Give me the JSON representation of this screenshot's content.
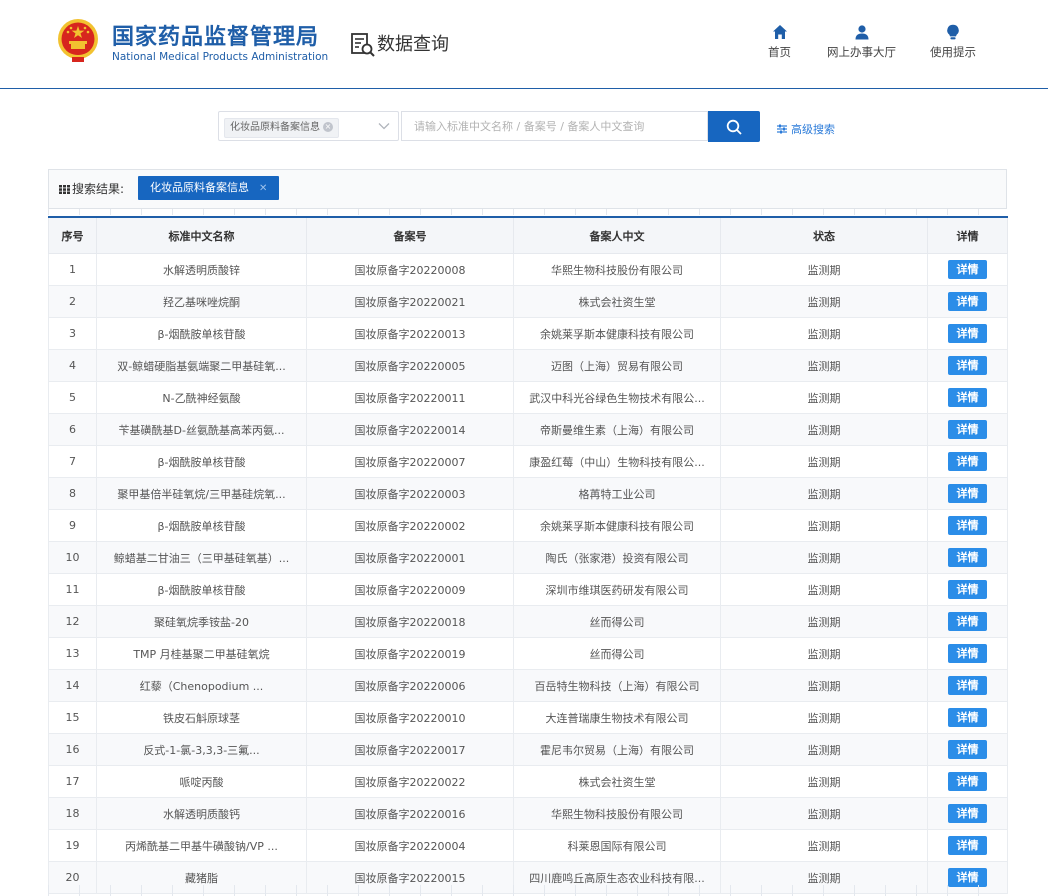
{
  "header": {
    "brand_cn": "国家药品监督管理局",
    "brand_en": "National Medical Products Administration",
    "section_title": "数据查询",
    "nav": [
      {
        "label": "首页",
        "icon": "home-icon"
      },
      {
        "label": "网上办事大厅",
        "icon": "user-icon"
      },
      {
        "label": "使用提示",
        "icon": "lightbulb-icon"
      }
    ]
  },
  "search": {
    "selected_category": "化妆品原料备案信息",
    "placeholder": "请输入标准中文名称 / 备案号 / 备案人中文查询",
    "advanced_label": "高级搜索"
  },
  "results": {
    "label": "搜索结果:",
    "tag": "化妆品原料备案信息"
  },
  "table": {
    "columns": [
      "序号",
      "标准中文名称",
      "备案号",
      "备案人中文",
      "状态",
      "详情"
    ],
    "detail_label": "详情",
    "rows": [
      [
        "1",
        "水解透明质酸锌",
        "国妆原备字20220008",
        "华熙生物科技股份有限公司",
        "监测期"
      ],
      [
        "2",
        "羟乙基咪唑烷酮",
        "国妆原备字20220021",
        "株式会社资生堂",
        "监测期"
      ],
      [
        "3",
        "β-烟酰胺单核苷酸",
        "国妆原备字20220013",
        "余姚莱孚斯本健康科技有限公司",
        "监测期"
      ],
      [
        "4",
        "双-鲸蜡硬脂基氨端聚二甲基硅氧...",
        "国妆原备字20220005",
        "迈图（上海）贸易有限公司",
        "监测期"
      ],
      [
        "5",
        "N-乙酰神经氨酸",
        "国妆原备字20220011",
        "武汉中科光谷绿色生物技术有限公...",
        "监测期"
      ],
      [
        "6",
        "苄基磺酰基D-丝氨酰基高苯丙氨...",
        "国妆原备字20220014",
        "帝斯曼维生素（上海）有限公司",
        "监测期"
      ],
      [
        "7",
        "β-烟酰胺单核苷酸",
        "国妆原备字20220007",
        "康盈红莓（中山）生物科技有限公...",
        "监测期"
      ],
      [
        "8",
        "聚甲基倍半硅氧烷/三甲基硅烷氧...",
        "国妆原备字20220003",
        "格苒特工业公司",
        "监测期"
      ],
      [
        "9",
        "β-烟酰胺单核苷酸",
        "国妆原备字20220002",
        "余姚莱孚斯本健康科技有限公司",
        "监测期"
      ],
      [
        "10",
        "鲸蜡基二甘油三（三甲基硅氧基）...",
        "国妆原备字20220001",
        "陶氏（张家港）投资有限公司",
        "监测期"
      ],
      [
        "11",
        "β-烟酰胺单核苷酸",
        "国妆原备字20220009",
        "深圳市维琪医药研发有限公司",
        "监测期"
      ],
      [
        "12",
        "聚硅氧烷季铵盐-20",
        "国妆原备字20220018",
        "丝而得公司",
        "监测期"
      ],
      [
        "13",
        "TMP 月桂基聚二甲基硅氧烷",
        "国妆原备字20220019",
        "丝而得公司",
        "监测期"
      ],
      [
        "14",
        "红藜（Chenopodium ...",
        "国妆原备字20220006",
        "百岳特生物科技（上海）有限公司",
        "监测期"
      ],
      [
        "15",
        "铁皮石斛原球茎",
        "国妆原备字20220010",
        "大连普瑞康生物技术有限公司",
        "监测期"
      ],
      [
        "16",
        "反式-1-氯-3,3,3-三氟...",
        "国妆原备字20220017",
        "霍尼韦尔贸易（上海）有限公司",
        "监测期"
      ],
      [
        "17",
        "哌啶丙酸",
        "国妆原备字20220022",
        "株式会社资生堂",
        "监测期"
      ],
      [
        "18",
        "水解透明质酸钙",
        "国妆原备字20220016",
        "华熙生物科技股份有限公司",
        "监测期"
      ],
      [
        "19",
        "丙烯酰基二甲基牛磺酸钠/VP ...",
        "国妆原备字20220004",
        "科莱恩国际有限公司",
        "监测期"
      ],
      [
        "20",
        "藏猪脂",
        "国妆原备字20220015",
        "四川鹿鸣丘高原生态农业科技有限...",
        "监测期"
      ]
    ]
  },
  "colors": {
    "brand_blue": "#1f5ea8",
    "button_blue": "#1766c0",
    "detail_blue": "#2b8de8",
    "emblem_red": "#d7261e",
    "emblem_gold": "#f2c230"
  }
}
